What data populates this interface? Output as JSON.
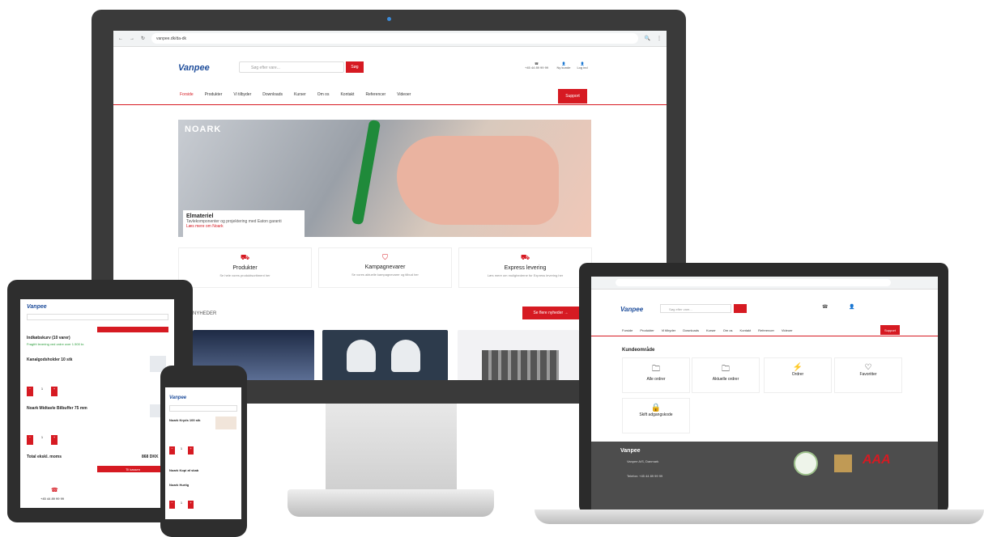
{
  "browser": {
    "url": "vanpee.dk/da-dk"
  },
  "brand": {
    "logo": "Vanpee",
    "accent": "#d61a22",
    "logo_color": "#1e4d9b"
  },
  "desktop": {
    "search_placeholder": "Søg efter vare...",
    "search_button": "Søg",
    "header_actions": [
      {
        "icon": "phone-icon",
        "label": "+45 44 89 99 99"
      },
      {
        "icon": "user-icon",
        "label": "Ny kunde"
      },
      {
        "icon": "user-icon",
        "label": "Log ind"
      }
    ],
    "nav": [
      "Forside",
      "Produkter",
      "Vi tilbyder",
      "Downloads",
      "Kurser",
      "Om os",
      "Kontakt",
      "Referencer",
      "Videoer"
    ],
    "support_button": "Support",
    "hero": {
      "brand": "NOARK",
      "title": "Elmateriel",
      "subtitle": "Tavlekomponenter og projektering med Eaton garanti",
      "link": "Læs mere om Noark"
    },
    "features": [
      {
        "icon": "truck-icon",
        "title": "Produkter",
        "subtitle": "Se hele vores produktsortiment her"
      },
      {
        "icon": "tag-icon",
        "title": "Kampagnevarer",
        "subtitle": "Se vores aktuelle kampagnevarer og tilbud her"
      },
      {
        "icon": "delivery-icon",
        "title": "Express levering",
        "subtitle": "Læs mere om mulighederne for Express levering her"
      }
    ],
    "news_heading": "NYHEDER",
    "news_button": "Se flere nyheder"
  },
  "tablet": {
    "logo": "Vanpee",
    "cart_title": "Indkøbskurv (10 varer)",
    "cart_note": "Fragtfri levering ved ordre over 1.500 kr.",
    "items": [
      {
        "title": "Kanalgodsholder 10 stk",
        "qty": "1"
      },
      {
        "title": "Noark Midtavle Bilbuffer 75 mm",
        "qty": "1"
      }
    ],
    "total_label": "Total ekskl. moms",
    "total_value": "868 DKK",
    "checkout_button": "Til kassen",
    "phone": "+45 44 89 99 99"
  },
  "phone": {
    "logo": "Vanpee",
    "items": [
      "Noark Kryds 100 stk",
      "Noark Kopi af skab",
      "Noark Hurtig"
    ],
    "qty": "1"
  },
  "laptop": {
    "search_placeholder": "Søg efter vare...",
    "nav": [
      "Forside",
      "Produkter",
      "Vi tilbyder",
      "Downloads",
      "Kurser",
      "Om os",
      "Kontakt",
      "Referencer",
      "Videoer"
    ],
    "support_button": "Support",
    "section_title": "Kundeområde",
    "cards": [
      {
        "icon": "folder-icon",
        "title": "Alle ordrer"
      },
      {
        "icon": "folder-icon",
        "title": "Aktuelle ordrer"
      },
      {
        "icon": "bolt-icon",
        "title": "Ordrer"
      },
      {
        "icon": "heart-icon",
        "title": "Favoritter"
      },
      {
        "icon": "lock-icon",
        "title": "Skift adgangskode"
      }
    ],
    "footer": {
      "logo": "Vanpee",
      "address": "Vanpee A/S, Danmark",
      "contact": "Telefon: +45 44 89 99 99",
      "badge": "AAA"
    }
  }
}
